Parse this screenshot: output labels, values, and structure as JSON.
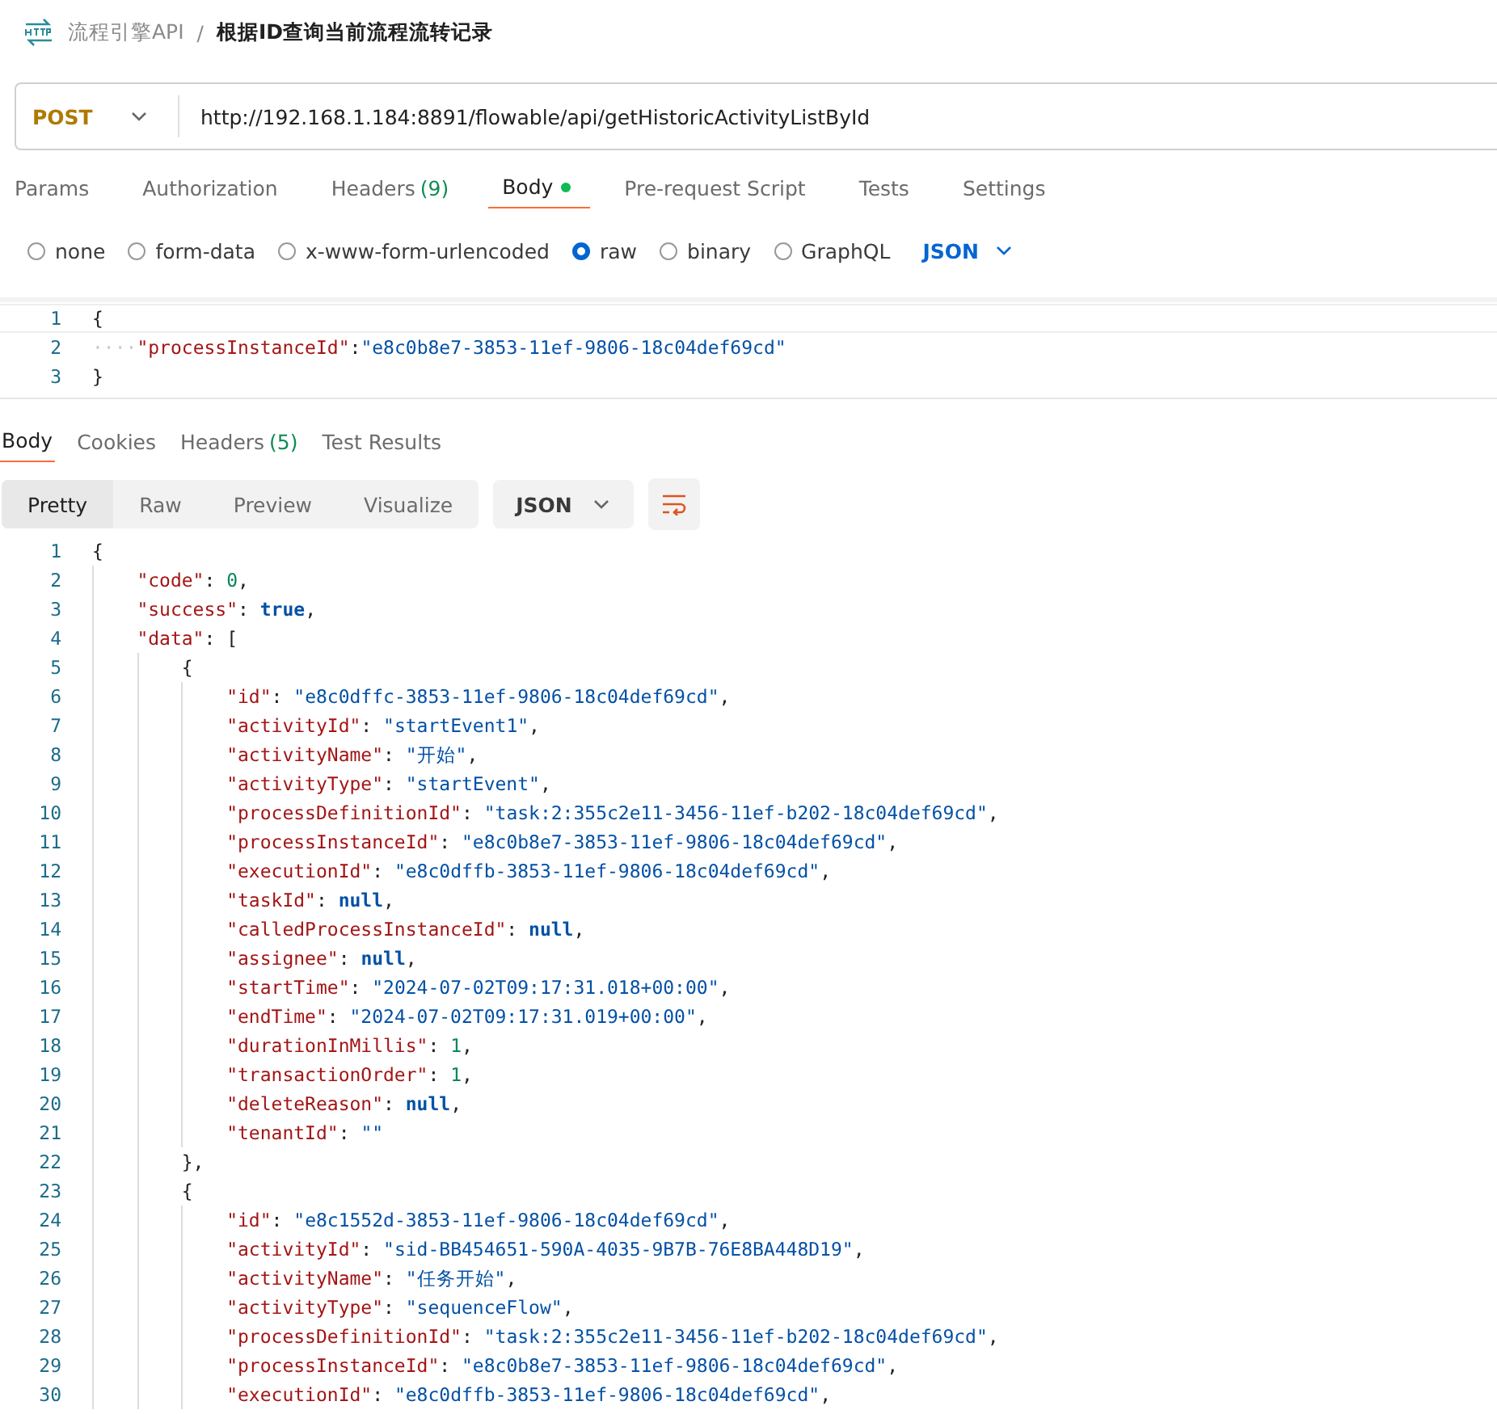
{
  "breadcrumb": {
    "collection": "流程引擎API",
    "separator": "/",
    "request": "根据ID查询当前流程流转记录"
  },
  "request": {
    "method": "POST",
    "url": "http://192.168.1.184:8891/flowable/api/getHistoricActivityListById"
  },
  "tabs": [
    {
      "label": "Params",
      "selected": false,
      "dot": false
    },
    {
      "label": "Authorization",
      "selected": false,
      "dot": false
    },
    {
      "label": "Headers",
      "count": "(9)",
      "selected": false,
      "dot": false
    },
    {
      "label": "Body",
      "selected": true,
      "dot": true
    },
    {
      "label": "Pre-request Script",
      "selected": false,
      "dot": false
    },
    {
      "label": "Tests",
      "selected": false,
      "dot": false
    },
    {
      "label": "Settings",
      "selected": false,
      "dot": false
    }
  ],
  "body_types": [
    {
      "label": "none",
      "selected": false
    },
    {
      "label": "form-data",
      "selected": false
    },
    {
      "label": "x-www-form-urlencoded",
      "selected": false
    },
    {
      "label": "raw",
      "selected": true
    },
    {
      "label": "binary",
      "selected": false
    },
    {
      "label": "GraphQL",
      "selected": false
    }
  ],
  "raw_format": "JSON",
  "request_body": [
    {
      "number": "1",
      "tokens": [
        {
          "kind": "punct",
          "text": "{"
        }
      ]
    },
    {
      "number": "2",
      "tokens": [
        {
          "kind": "ws",
          "text": "····"
        },
        {
          "kind": "key",
          "text": "\"processInstanceId\""
        },
        {
          "kind": "punct",
          "text": ":"
        },
        {
          "kind": "str",
          "text": "\"e8c0b8e7-3853-11ef-9806-18c04def69cd\""
        }
      ]
    },
    {
      "number": "3",
      "tokens": [
        {
          "kind": "punct",
          "text": "}"
        }
      ]
    }
  ],
  "response_tabs": [
    {
      "label": "Body",
      "selected": true
    },
    {
      "label": "Cookies",
      "selected": false
    },
    {
      "label": "Headers",
      "count": "(5)",
      "selected": false
    },
    {
      "label": "Test Results",
      "selected": false
    }
  ],
  "view_modes": [
    {
      "label": "Pretty",
      "selected": true
    },
    {
      "label": "Raw",
      "selected": false
    },
    {
      "label": "Preview",
      "selected": false
    },
    {
      "label": "Visualize",
      "selected": false
    }
  ],
  "response_format": "JSON",
  "response_body": [
    {
      "number": "1",
      "tokens": [
        {
          "kind": "punct",
          "text": "{"
        }
      ],
      "children": [
        {
          "number": "2",
          "tokens": [
            {
              "kind": "key",
              "text": "\"code\""
            },
            {
              "kind": "punct",
              "text": ": "
            },
            {
              "kind": "num",
              "text": "0"
            },
            {
              "kind": "punct",
              "text": ","
            }
          ]
        },
        {
          "number": "3",
          "tokens": [
            {
              "kind": "key",
              "text": "\"success\""
            },
            {
              "kind": "punct",
              "text": ": "
            },
            {
              "kind": "lit",
              "text": "true"
            },
            {
              "kind": "punct",
              "text": ","
            }
          ]
        },
        {
          "number": "4",
          "tokens": [
            {
              "kind": "key",
              "text": "\"data\""
            },
            {
              "kind": "punct",
              "text": ": ["
            }
          ],
          "children": [
            {
              "number": "5",
              "tokens": [
                {
                  "kind": "punct",
                  "text": "{"
                }
              ],
              "children": [
                {
                  "number": "6",
                  "tokens": [
                    {
                      "kind": "key",
                      "text": "\"id\""
                    },
                    {
                      "kind": "punct",
                      "text": ": "
                    },
                    {
                      "kind": "str",
                      "text": "\"e8c0dffc-3853-11ef-9806-18c04def69cd\""
                    },
                    {
                      "kind": "punct",
                      "text": ","
                    }
                  ]
                },
                {
                  "number": "7",
                  "tokens": [
                    {
                      "kind": "key",
                      "text": "\"activityId\""
                    },
                    {
                      "kind": "punct",
                      "text": ": "
                    },
                    {
                      "kind": "str",
                      "text": "\"startEvent1\""
                    },
                    {
                      "kind": "punct",
                      "text": ","
                    }
                  ]
                },
                {
                  "number": "8",
                  "tokens": [
                    {
                      "kind": "key",
                      "text": "\"activityName\""
                    },
                    {
                      "kind": "punct",
                      "text": ": "
                    },
                    {
                      "kind": "str",
                      "text": "\"开始\""
                    },
                    {
                      "kind": "punct",
                      "text": ","
                    }
                  ]
                },
                {
                  "number": "9",
                  "tokens": [
                    {
                      "kind": "key",
                      "text": "\"activityType\""
                    },
                    {
                      "kind": "punct",
                      "text": ": "
                    },
                    {
                      "kind": "str",
                      "text": "\"startEvent\""
                    },
                    {
                      "kind": "punct",
                      "text": ","
                    }
                  ]
                },
                {
                  "number": "10",
                  "tokens": [
                    {
                      "kind": "key",
                      "text": "\"processDefinitionId\""
                    },
                    {
                      "kind": "punct",
                      "text": ": "
                    },
                    {
                      "kind": "str",
                      "text": "\"task:2:355c2e11-3456-11ef-b202-18c04def69cd\""
                    },
                    {
                      "kind": "punct",
                      "text": ","
                    }
                  ]
                },
                {
                  "number": "11",
                  "tokens": [
                    {
                      "kind": "key",
                      "text": "\"processInstanceId\""
                    },
                    {
                      "kind": "punct",
                      "text": ": "
                    },
                    {
                      "kind": "str",
                      "text": "\"e8c0b8e7-3853-11ef-9806-18c04def69cd\""
                    },
                    {
                      "kind": "punct",
                      "text": ","
                    }
                  ]
                },
                {
                  "number": "12",
                  "tokens": [
                    {
                      "kind": "key",
                      "text": "\"executionId\""
                    },
                    {
                      "kind": "punct",
                      "text": ": "
                    },
                    {
                      "kind": "str",
                      "text": "\"e8c0dffb-3853-11ef-9806-18c04def69cd\""
                    },
                    {
                      "kind": "punct",
                      "text": ","
                    }
                  ]
                },
                {
                  "number": "13",
                  "tokens": [
                    {
                      "kind": "key",
                      "text": "\"taskId\""
                    },
                    {
                      "kind": "punct",
                      "text": ": "
                    },
                    {
                      "kind": "lit",
                      "text": "null"
                    },
                    {
                      "kind": "punct",
                      "text": ","
                    }
                  ]
                },
                {
                  "number": "14",
                  "tokens": [
                    {
                      "kind": "key",
                      "text": "\"calledProcessInstanceId\""
                    },
                    {
                      "kind": "punct",
                      "text": ": "
                    },
                    {
                      "kind": "lit",
                      "text": "null"
                    },
                    {
                      "kind": "punct",
                      "text": ","
                    }
                  ]
                },
                {
                  "number": "15",
                  "tokens": [
                    {
                      "kind": "key",
                      "text": "\"assignee\""
                    },
                    {
                      "kind": "punct",
                      "text": ": "
                    },
                    {
                      "kind": "lit",
                      "text": "null"
                    },
                    {
                      "kind": "punct",
                      "text": ","
                    }
                  ]
                },
                {
                  "number": "16",
                  "tokens": [
                    {
                      "kind": "key",
                      "text": "\"startTime\""
                    },
                    {
                      "kind": "punct",
                      "text": ": "
                    },
                    {
                      "kind": "str",
                      "text": "\"2024-07-02T09:17:31.018+00:00\""
                    },
                    {
                      "kind": "punct",
                      "text": ","
                    }
                  ]
                },
                {
                  "number": "17",
                  "tokens": [
                    {
                      "kind": "key",
                      "text": "\"endTime\""
                    },
                    {
                      "kind": "punct",
                      "text": ": "
                    },
                    {
                      "kind": "str",
                      "text": "\"2024-07-02T09:17:31.019+00:00\""
                    },
                    {
                      "kind": "punct",
                      "text": ","
                    }
                  ]
                },
                {
                  "number": "18",
                  "tokens": [
                    {
                      "kind": "key",
                      "text": "\"durationInMillis\""
                    },
                    {
                      "kind": "punct",
                      "text": ": "
                    },
                    {
                      "kind": "num",
                      "text": "1"
                    },
                    {
                      "kind": "punct",
                      "text": ","
                    }
                  ]
                },
                {
                  "number": "19",
                  "tokens": [
                    {
                      "kind": "key",
                      "text": "\"transactionOrder\""
                    },
                    {
                      "kind": "punct",
                      "text": ": "
                    },
                    {
                      "kind": "num",
                      "text": "1"
                    },
                    {
                      "kind": "punct",
                      "text": ","
                    }
                  ]
                },
                {
                  "number": "20",
                  "tokens": [
                    {
                      "kind": "key",
                      "text": "\"deleteReason\""
                    },
                    {
                      "kind": "punct",
                      "text": ": "
                    },
                    {
                      "kind": "lit",
                      "text": "null"
                    },
                    {
                      "kind": "punct",
                      "text": ","
                    }
                  ]
                },
                {
                  "number": "21",
                  "tokens": [
                    {
                      "kind": "key",
                      "text": "\"tenantId\""
                    },
                    {
                      "kind": "punct",
                      "text": ": "
                    },
                    {
                      "kind": "str",
                      "text": "\"\""
                    }
                  ]
                }
              ]
            },
            {
              "number": "22",
              "tokens": [
                {
                  "kind": "punct",
                  "text": "},"
                }
              ]
            },
            {
              "number": "23",
              "tokens": [
                {
                  "kind": "punct",
                  "text": "{"
                }
              ],
              "children": [
                {
                  "number": "24",
                  "tokens": [
                    {
                      "kind": "key",
                      "text": "\"id\""
                    },
                    {
                      "kind": "punct",
                      "text": ": "
                    },
                    {
                      "kind": "str",
                      "text": "\"e8c1552d-3853-11ef-9806-18c04def69cd\""
                    },
                    {
                      "kind": "punct",
                      "text": ","
                    }
                  ]
                },
                {
                  "number": "25",
                  "tokens": [
                    {
                      "kind": "key",
                      "text": "\"activityId\""
                    },
                    {
                      "kind": "punct",
                      "text": ": "
                    },
                    {
                      "kind": "str",
                      "text": "\"sid-BB454651-590A-4035-9B7B-76E8BA448D19\""
                    },
                    {
                      "kind": "punct",
                      "text": ","
                    }
                  ]
                },
                {
                  "number": "26",
                  "tokens": [
                    {
                      "kind": "key",
                      "text": "\"activityName\""
                    },
                    {
                      "kind": "punct",
                      "text": ": "
                    },
                    {
                      "kind": "str",
                      "text": "\"任务开始\""
                    },
                    {
                      "kind": "punct",
                      "text": ","
                    }
                  ]
                },
                {
                  "number": "27",
                  "tokens": [
                    {
                      "kind": "key",
                      "text": "\"activityType\""
                    },
                    {
                      "kind": "punct",
                      "text": ": "
                    },
                    {
                      "kind": "str",
                      "text": "\"sequenceFlow\""
                    },
                    {
                      "kind": "punct",
                      "text": ","
                    }
                  ]
                },
                {
                  "number": "28",
                  "tokens": [
                    {
                      "kind": "key",
                      "text": "\"processDefinitionId\""
                    },
                    {
                      "kind": "punct",
                      "text": ": "
                    },
                    {
                      "kind": "str",
                      "text": "\"task:2:355c2e11-3456-11ef-b202-18c04def69cd\""
                    },
                    {
                      "kind": "punct",
                      "text": ","
                    }
                  ]
                },
                {
                  "number": "29",
                  "tokens": [
                    {
                      "kind": "key",
                      "text": "\"processInstanceId\""
                    },
                    {
                      "kind": "punct",
                      "text": ": "
                    },
                    {
                      "kind": "str",
                      "text": "\"e8c0b8e7-3853-11ef-9806-18c04def69cd\""
                    },
                    {
                      "kind": "punct",
                      "text": ","
                    }
                  ]
                },
                {
                  "number": "30",
                  "tokens": [
                    {
                      "kind": "key",
                      "text": "\"executionId\""
                    },
                    {
                      "kind": "punct",
                      "text": ": "
                    },
                    {
                      "kind": "str",
                      "text": "\"e8c0dffb-3853-11ef-9806-18c04def69cd\""
                    },
                    {
                      "kind": "punct",
                      "text": ","
                    }
                  ]
                }
              ]
            }
          ]
        }
      ]
    }
  ]
}
